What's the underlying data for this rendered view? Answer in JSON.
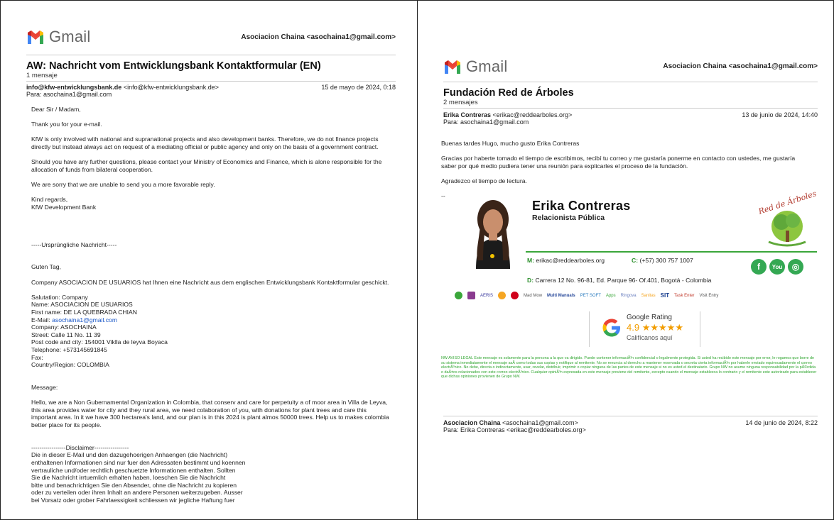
{
  "app_name": "Gmail",
  "left": {
    "owner": "Asociacion Chaina <asochaina1@gmail.com>",
    "subject": "AW: Nachricht vom Entwicklungsbank Kontaktformular (EN)",
    "count": "1 mensaje",
    "from_name": "info@kfw-entwicklungsbank.de",
    "from_addr": "<info@kfw-entwicklungsbank.de>",
    "to": "Para: asochaina1@gmail.com",
    "date": "15 de mayo de 2024, 0:18",
    "body": [
      "Dear Sir / Madam,",
      "",
      "Thank you for your e-mail.",
      "",
      "KfW is only involved with national and supranational projects and also development banks. Therefore, we do not finance projects directly but instead always act on request of a mediating official or public agency and only on the basis of a government contract.",
      "",
      "Should you have any further questions, please contact your Ministry of Economics and Finance, which is alone responsible for the allocation of funds from bilateral cooperation.",
      "",
      "We are sorry that we are unable to send you a more favorable reply.",
      "",
      "Kind regards,",
      "KfW Development Bank",
      "",
      "",
      "",
      "",
      "-----Ursprüngliche Nachricht-----",
      "",
      "",
      "Guten Tag,",
      "",
      "Company ASOCIACION DE USUARIOS hat Ihnen eine Nachricht aus dem englischen Entwicklungsbank Kontaktformular geschickt.",
      "",
      "Salutation: Company",
      "Name: ASOCIACION DE USUARIOS",
      "First name: DE LA QUEBRADA CHIAN"
    ],
    "email_label": "E-Mail: ",
    "email_value": "asochaina1@gmail.com",
    "body2": [
      "Company: ASOCHAINA",
      "Street: Calle 11 No. 11 39",
      "Post code and city: 154001 Viklla de leyva Boyaca",
      "Telephone: +573145691845",
      "Fax:",
      "Country/Region: COLOMBIA",
      "",
      "",
      "Message:",
      "",
      "Hello, we are a Non Gubernamental Organization in Colombia, that conserv and care for  perpetuity a of moor area in Villa de Leyva, this area provides water for city and they rural area, we need colaboration of you, with donations for plant trees and care this important area. In it we have 300 hectarea's land, and our plan is in this 2024 is plant almos 50000 trees. Help us to makes colombia better place for its people.",
      "",
      "",
      "-----------------Disclaimer-----------------",
      "Die in dieser E-Mail und den dazugehoerigen Anhaengen (die Nachricht)",
      "enthaltenen Informationen sind nur fuer den Adressaten bestimmt und koennen",
      "vertrauliche und/oder rechtlich geschuetzte Informationen enthalten. Sollten",
      "Sie die Nachricht irrtuemlich erhalten haben, loeschen Sie die Nachricht",
      "bitte und benachrichtigen Sie den Absender, ohne die Nachricht zu kopieren",
      "oder zu verteilen oder ihren Inhalt an andere Personen weiterzugeben. Ausser",
      "bei Vorsatz oder grober Fahrlaessigkeit schliessen wir jegliche Haftung fuer"
    ]
  },
  "right": {
    "owner": "Asociacion Chaina <asochaina1@gmail.com>",
    "subject": "Fundación Red de Árboles",
    "count": "2 mensajes",
    "from_name": "Erika Contreras",
    "from_addr": "<erikac@reddearboles.org>",
    "to": "Para: asochaina1@gmail.com",
    "date": "13 de junio de 2024, 14:40",
    "body": [
      "Buenas tardes Hugo, mucho gusto Erika Contreras",
      "",
      "Gracias por haberte tomado el tiempo de escribimos, recibí tu correo y me gustaría ponerme en contacto con ustedes, me gustaría saber por qué medio pudiera tener una reunión para explicarles el proceso de la fundación.",
      "",
      "Agradezco el tiempo de lectura.",
      "",
      "--"
    ],
    "signature": {
      "name": "Erika Contreras",
      "role": "Relacionista Pública",
      "m_label": "M:",
      "m_value": "erikac@reddearboles.org",
      "c_label": "C:",
      "c_value": "(+57) 300 757 1007",
      "d_label": "D:",
      "d_value": "Carrera 12 No. 96-81, Ed. Parque 96- Of.401, Bogotá - Colombia",
      "logo_text": "Red de Árboles",
      "social": [
        "f",
        "You",
        "◎"
      ]
    },
    "partner_logos": [
      "AERIS",
      "Mad Mow",
      "Multi Manuals",
      "PET SOFT",
      "Apps",
      "Ringova",
      "Sanitas",
      "SIT",
      "Task Enter",
      "Visit Entry"
    ],
    "rating": {
      "title": "Google Rating",
      "score": "4.9",
      "stars": "★★★★★",
      "sub": "Califícanos aquí"
    },
    "legal": "NW AVISO LEGAL Este mensaje es solamente para la persona a la que va dirigido. Puede contener informaciÃ³n confidencial o legalmente protegida. Si usted ha recibido este mensaje por error, le rogamos que borre de su sistema inmediatamente el mensaje asÃ­ como todas sus copias y notifique al remitente. No se renuncia al derecho a mantener reservada o secreta cierta informaciÃ³n por haberle enviado equivocadamente el correo electrÃ³nico. No debe, directa o indirectamente, usar, revelar, distribuir, imprimir o copiar ninguna de las partes de este mensaje si no es usted el destinatario. Grupo NW no asume ninguna responsabilidad por la pÃ©rdida o daÃ±os relacionados con este correo electrÃ³nico. Cualquier opiniÃ³n expresada en este mensaje proviene del remitente, excepto cuando el mensaje establezca lo contrario y el remitente este autorizado para establecer que dichas opiniones provienen de Grupo NW.",
    "reply": {
      "from_name": "Asociacion Chaina",
      "from_addr": "<asochaina1@gmail.com>",
      "to": "Para: Erika Contreras <erikac@reddearboles.org>",
      "date": "14 de junio de 2024, 8:22"
    }
  },
  "colors": {
    "gmail_red": "#ea4335",
    "gmail_blue": "#4285f4",
    "gmail_green": "#34a853",
    "gmail_yellow": "#fbbc04",
    "signature_green": "#3aa63a",
    "link_blue": "#1a57c7",
    "star_orange": "#f29d00"
  }
}
